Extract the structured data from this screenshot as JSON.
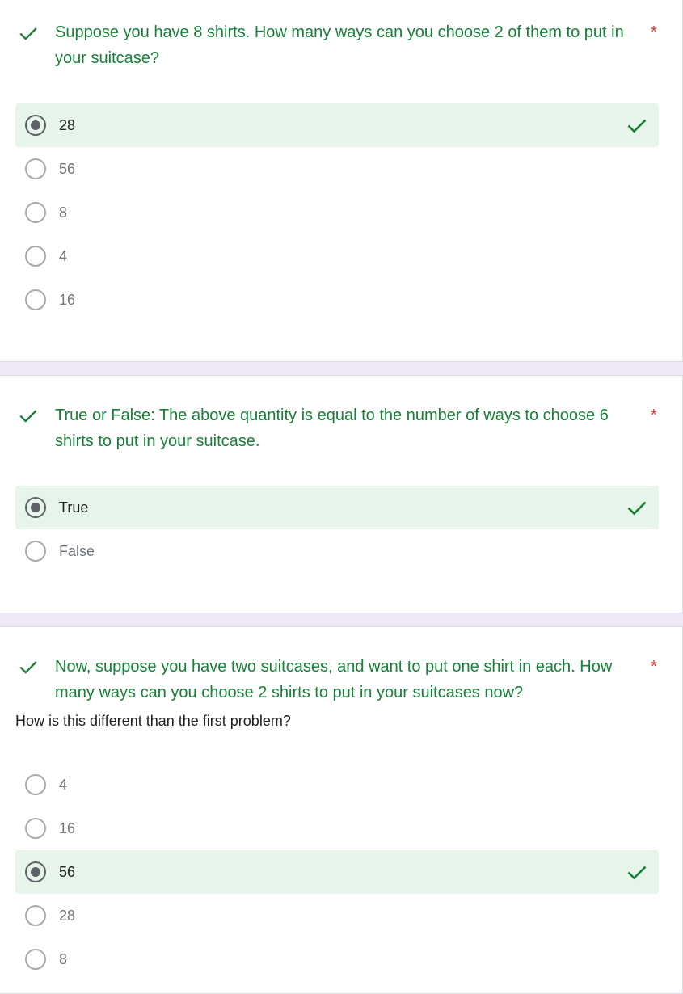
{
  "required_marker": "*",
  "colors": {
    "correct_text": "#188038",
    "correct_bg": "#e6f4ea",
    "required": "#d93025",
    "page_bg": "#ede7f6"
  },
  "questions": [
    {
      "title": "Suppose you have 8 shirts. How many ways can you choose 2 of them to put in your suitcase?",
      "status_icon": "check-icon",
      "options": [
        {
          "label": "28",
          "selected": true,
          "correct": true
        },
        {
          "label": "56"
        },
        {
          "label": "8"
        },
        {
          "label": "4"
        },
        {
          "label": "16"
        }
      ]
    },
    {
      "title": "True or False: The above quantity is equal to the number of ways to choose 6 shirts to put in your suitcase.",
      "status_icon": "check-icon",
      "options": [
        {
          "label": "True",
          "selected": true,
          "correct": true
        },
        {
          "label": "False"
        }
      ]
    },
    {
      "title": "Now, suppose you have two suitcases, and want to put one shirt in each. How many ways can you choose 2 shirts to put in your suitcases now?",
      "description": "How is this different than the first problem?",
      "status_icon": "check-icon",
      "options": [
        {
          "label": "4"
        },
        {
          "label": "16"
        },
        {
          "label": "56",
          "selected": true,
          "correct": true
        },
        {
          "label": "28"
        },
        {
          "label": "8"
        }
      ]
    }
  ]
}
